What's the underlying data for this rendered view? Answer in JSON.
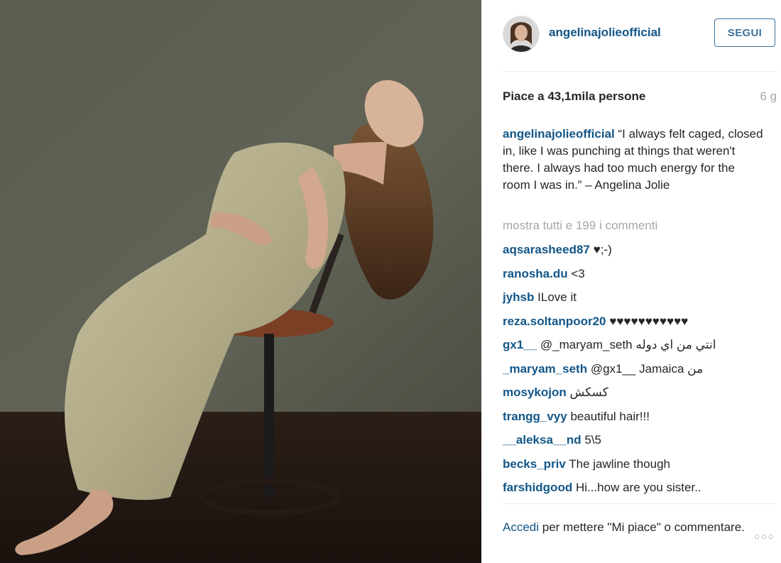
{
  "post": {
    "username": "angelinajolieofficial",
    "follow_label": "SEGUI",
    "likes": "Piace a 43,1mila persone",
    "time_ago": "6 g",
    "caption_user": "angelinajolieofficial",
    "caption_text": " “I always felt caged, closed in, like I was punching at things that weren't there. I always had too much energy for the room I was in.” – Angelina Jolie",
    "view_all_comments": "mostra tutti e 199 i commenti"
  },
  "comments": [
    {
      "user": "aqsarasheed87",
      "text": "♥;-)"
    },
    {
      "user": "ranosha.du",
      "text": "<3"
    },
    {
      "user": "jyhsb",
      "text": "ILove it"
    },
    {
      "user": "reza.soltanpoor20",
      "text": "♥♥♥♥♥♥♥♥♥♥♥"
    },
    {
      "user": "gx1__",
      "text": "@_maryam_seth انتي من اي دوله"
    },
    {
      "user": "_maryam_seth",
      "text": "@gx1__ Jamaica من"
    },
    {
      "user": "mosykojon",
      "text": "كسكش"
    },
    {
      "user": "trangg_vyy",
      "text": "beautiful hair!!!"
    },
    {
      "user": "__aleksa__nd",
      "text": "5\\5"
    },
    {
      "user": "becks_priv",
      "text": "The jawline though"
    },
    {
      "user": "farshidgood",
      "text": "Hi...how are you sister.."
    }
  ],
  "footer": {
    "login_label": "Accedi",
    "text": " per mettere \"Mi piace\" o commentare."
  },
  "icons": {
    "more_options": "more-options-icon"
  },
  "colors": {
    "link": "#125688",
    "follow": "#3f729b",
    "muted": "#a5a7aa"
  }
}
